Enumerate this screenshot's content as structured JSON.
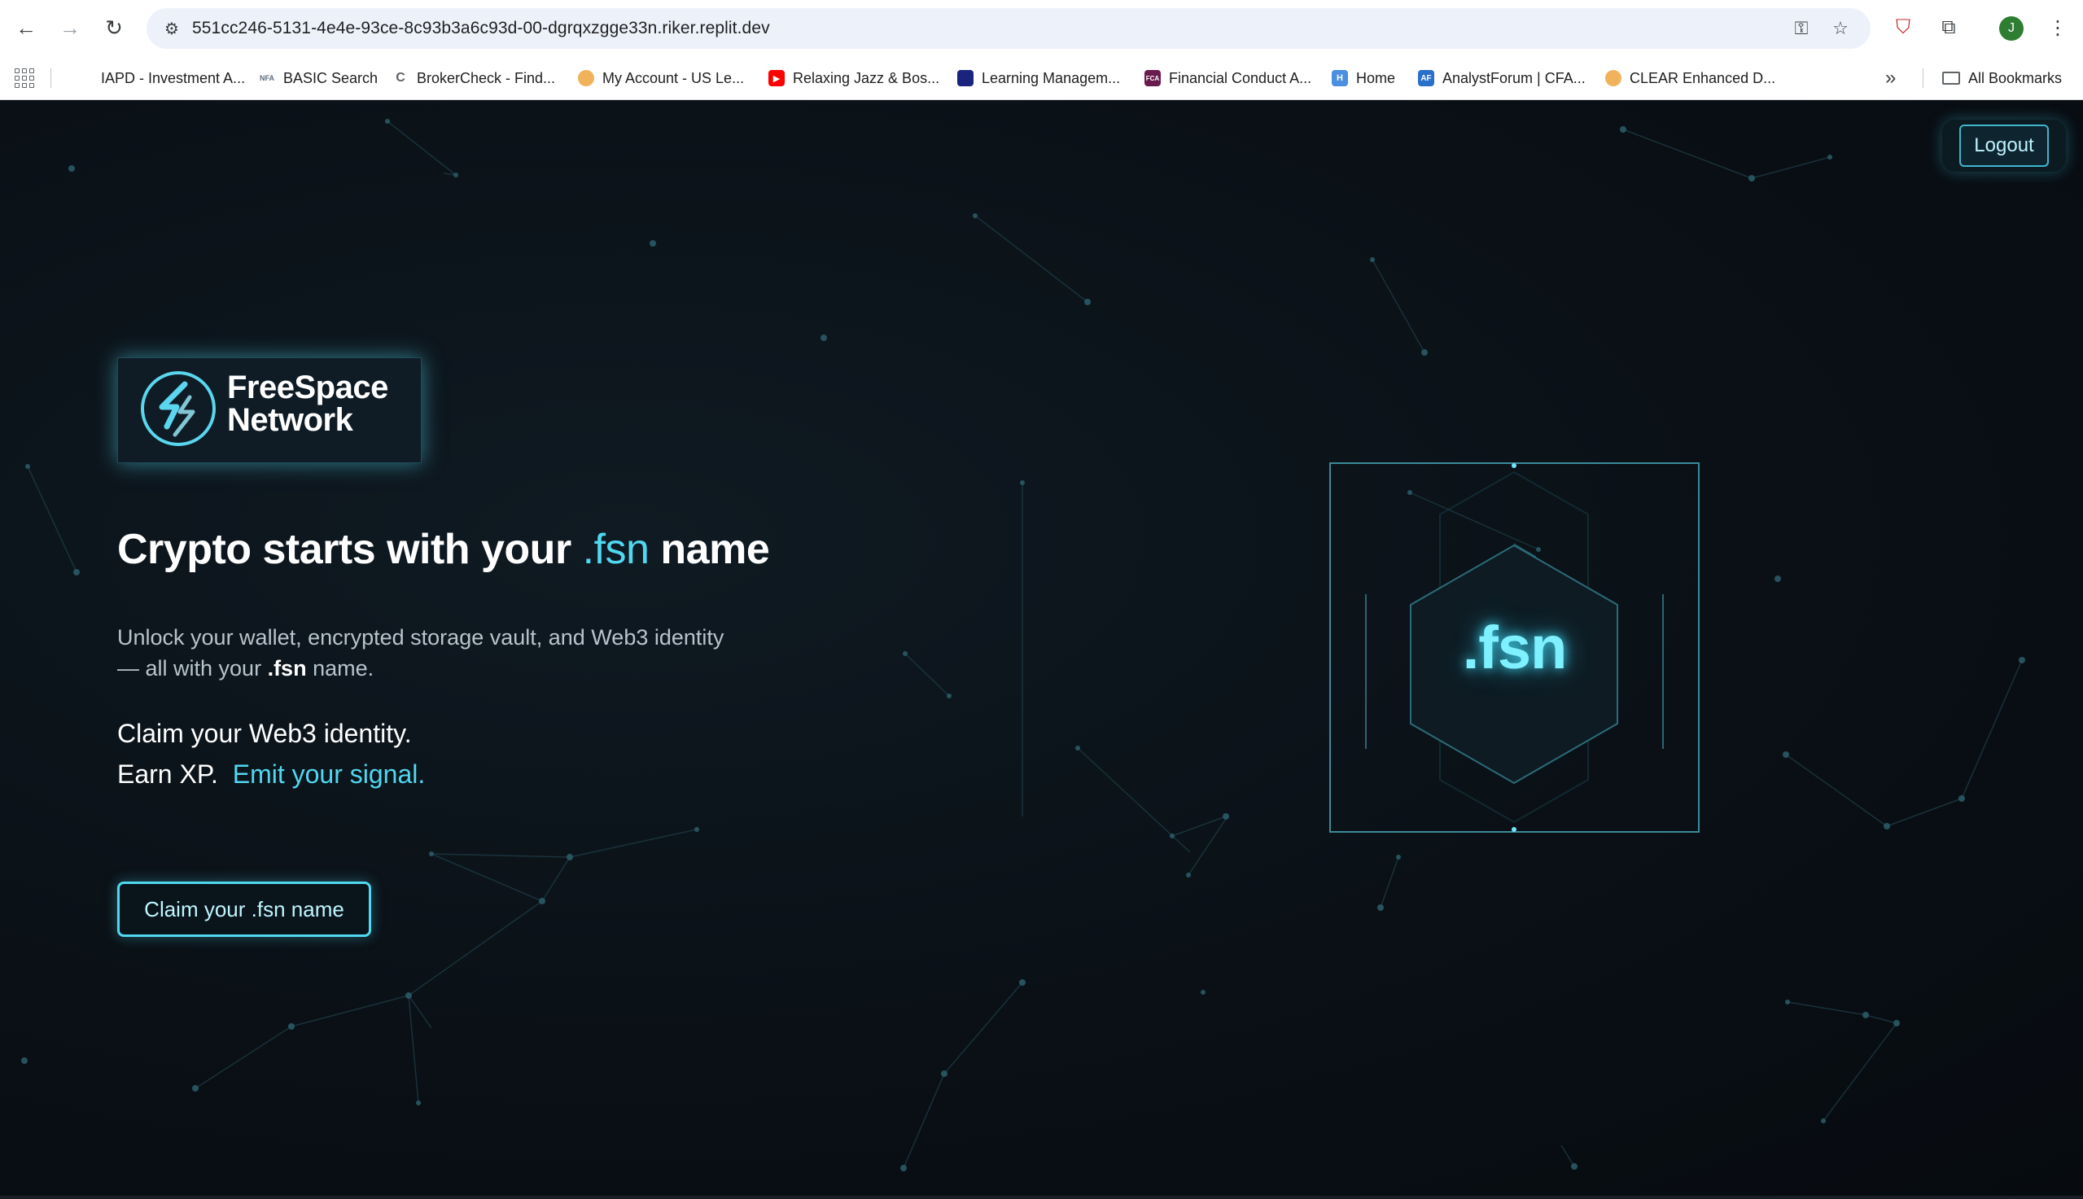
{
  "browser": {
    "url": "551cc246-5131-4e4e-93ce-8c93b3a6c93d-00-dgrqxzgge33n.riker.replit.dev",
    "avatar_letter": "J",
    "bookmarks": [
      {
        "label": "IAPD - Investment A...",
        "icon": "iapd-favicon",
        "color": "#ffffff"
      },
      {
        "label": "BASIC Search",
        "icon": "nfa-favicon",
        "color": "#5b6b7a"
      },
      {
        "label": "BrokerCheck - Find...",
        "icon": "brokercheck-favicon",
        "color": "#5f6368"
      },
      {
        "label": "My Account - US Le...",
        "icon": "usl-favicon",
        "color": "#f0b35c"
      },
      {
        "label": "Relaxing Jazz & Bos...",
        "icon": "youtube-favicon",
        "color": "#ff0000"
      },
      {
        "label": "Learning Managem...",
        "icon": "lms-favicon",
        "color": "#1a237e"
      },
      {
        "label": "Financial Conduct A...",
        "icon": "fca-favicon",
        "color": "#6a1b4d"
      },
      {
        "label": "Home",
        "icon": "home-favicon",
        "color": "#4a8fe0"
      },
      {
        "label": "AnalystForum | CFA...",
        "icon": "analystforum-favicon",
        "color": "#2a6fc9"
      },
      {
        "label": "CLEAR Enhanced D...",
        "icon": "clear-favicon",
        "color": "#f0b35c"
      }
    ],
    "all_bookmarks_label": "All Bookmarks"
  },
  "page": {
    "logout_label": "Logout",
    "logo": {
      "line1": "FreeSpace",
      "line2": "Network"
    },
    "headline": {
      "before": "Crypto starts with your ",
      "accent": ".fsn",
      "after": " name"
    },
    "subtitle": {
      "before": "Unlock your wallet, encrypted storage vault, and Web3 identity — all with your ",
      "bold": ".fsn",
      "after": " name."
    },
    "claim_line1": "Claim your Web3 identity.",
    "claim_line2_plain": "Earn XP.",
    "claim_line2_accent": "Emit your signal.",
    "cta_label": "Claim your .fsn name",
    "fsn_badge": ".fsn",
    "colors": {
      "accent": "#4fd8f0",
      "background": "#0a1016"
    }
  }
}
